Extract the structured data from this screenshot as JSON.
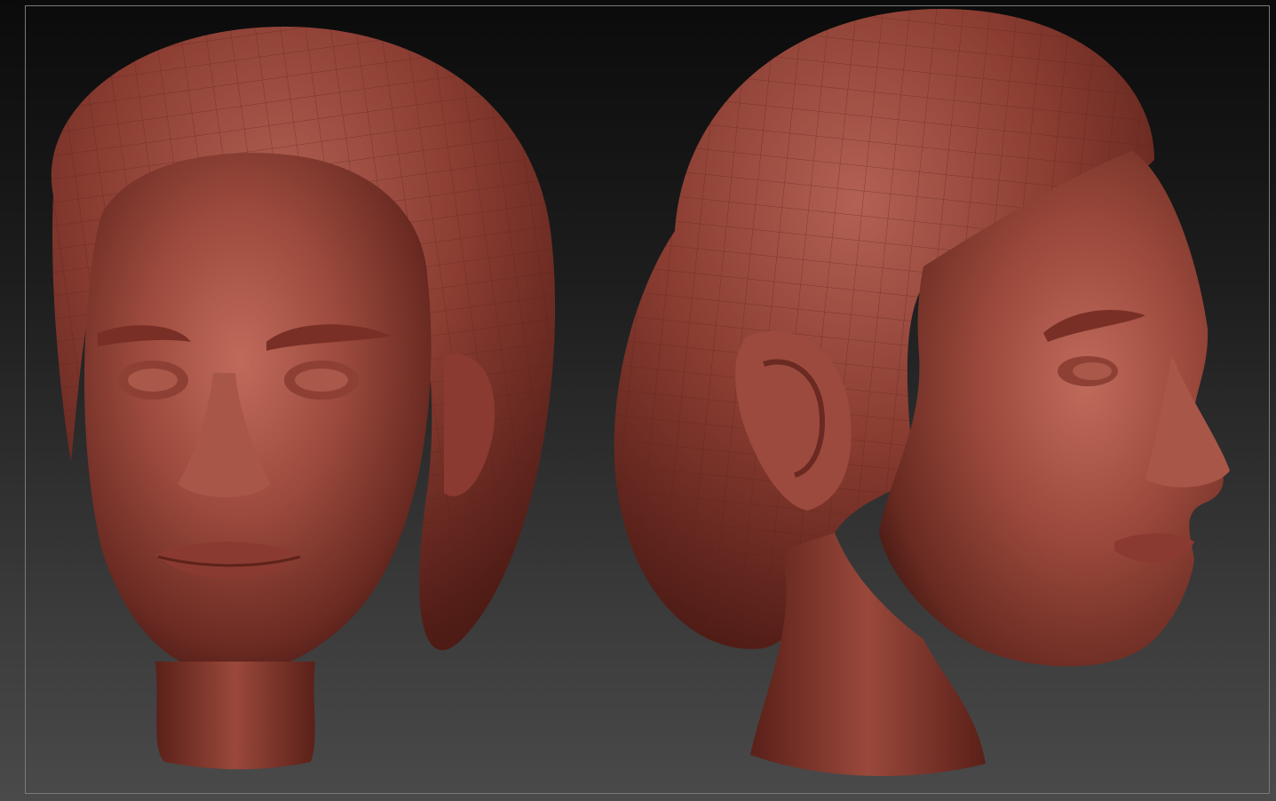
{
  "scene": {
    "viewport_background": "gradient-dark-gray",
    "frame_border_color": "#7a7a7a",
    "material_color": "#8a3a30",
    "hair_color": "#7e3a31",
    "models": [
      {
        "view": "front",
        "subject": "sculpted-head"
      },
      {
        "view": "three-quarter-profile",
        "subject": "sculpted-head"
      }
    ]
  }
}
